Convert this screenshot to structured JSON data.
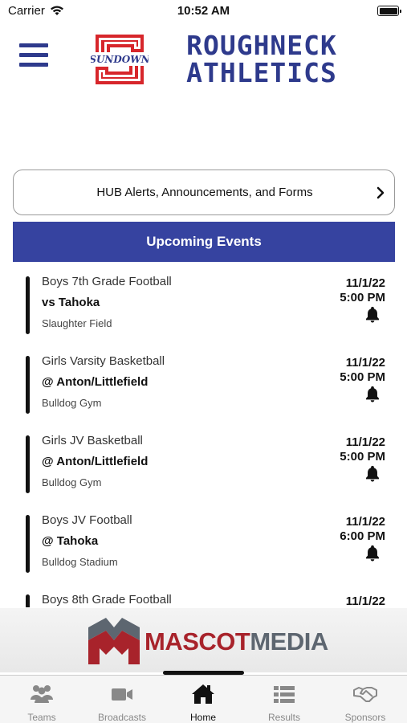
{
  "status_bar": {
    "carrier": "Carrier",
    "time": "10:52 AM"
  },
  "header": {
    "menu_icon": "hamburger-menu-icon",
    "logo_badge_text": "SUNDOWN",
    "title_line1": "ROUGHNECK",
    "title_line2": "ATHLETICS",
    "brand_color": "#2e3a8c",
    "logo_red": "#d7262b"
  },
  "hub": {
    "label": "HUB Alerts, Announcements, and Forms",
    "chevron_icon": "chevron-right-icon"
  },
  "events_section": {
    "title": "Upcoming Events",
    "header_color": "#3643a0",
    "items": [
      {
        "sport": "Boys 7th Grade Football",
        "opponent": "vs Tahoka",
        "venue": "Slaughter Field",
        "date": "11/1/22",
        "time": "5:00 PM"
      },
      {
        "sport": "Girls Varsity Basketball",
        "opponent": "@ Anton/Littlefield",
        "venue": "Bulldog Gym",
        "date": "11/1/22",
        "time": "5:00 PM"
      },
      {
        "sport": "Girls JV Basketball",
        "opponent": "@ Anton/Littlefield",
        "venue": "Bulldog Gym",
        "date": "11/1/22",
        "time": "5:00 PM"
      },
      {
        "sport": "Boys JV Football",
        "opponent": "@ Tahoka",
        "venue": "Bulldog Stadium",
        "date": "11/1/22",
        "time": "6:00 PM"
      },
      {
        "sport": "Boys 8th Grade Football",
        "opponent": "",
        "venue": "",
        "date": "11/1/22",
        "time": ""
      }
    ]
  },
  "sponsor": {
    "name_part1": "MASCOT",
    "name_part2": "MEDIA",
    "red": "#a8232b",
    "gray": "#5d6670"
  },
  "tab_bar": {
    "active": "Home",
    "tabs": [
      {
        "label": "Teams",
        "icon": "people-icon"
      },
      {
        "label": "Broadcasts",
        "icon": "video-camera-icon"
      },
      {
        "label": "Home",
        "icon": "home-icon"
      },
      {
        "label": "Results",
        "icon": "list-icon"
      },
      {
        "label": "Sponsors",
        "icon": "handshake-icon"
      }
    ]
  }
}
